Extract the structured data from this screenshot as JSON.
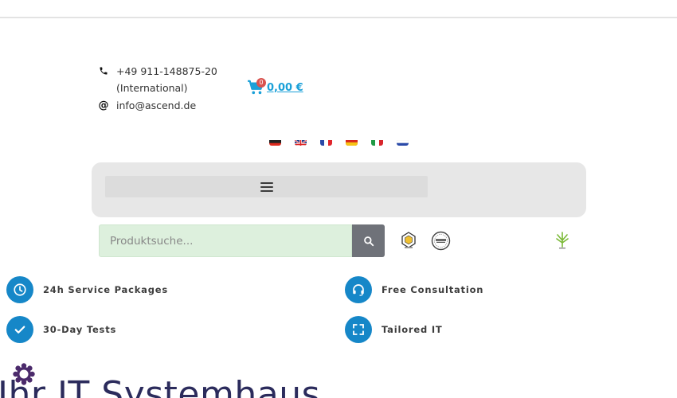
{
  "contact": {
    "phone": "+49 911-148875-20",
    "phone_note": "(International)",
    "email": "info@ascend.de"
  },
  "cart": {
    "count": "0",
    "total": "0,00 €"
  },
  "languages": [
    "de",
    "en",
    "fr",
    "es",
    "it",
    "ru"
  ],
  "search": {
    "placeholder": "Produktsuche..."
  },
  "features": [
    {
      "label": "24h Service Packages",
      "icon": "clock-icon"
    },
    {
      "label": "Free Consultation",
      "icon": "headset-icon"
    },
    {
      "label": "30-Day Tests",
      "icon": "check-icon"
    },
    {
      "label": "Tailored IT",
      "icon": "fullscreen-icon"
    }
  ],
  "hero": {
    "title": "Ihr IT Systemhaus"
  },
  "colors": {
    "accent": "#1687c8",
    "cart_link": "#1aa0d8",
    "search_bg": "#ddf0dd",
    "menu_bg": "#e7e7e7"
  }
}
